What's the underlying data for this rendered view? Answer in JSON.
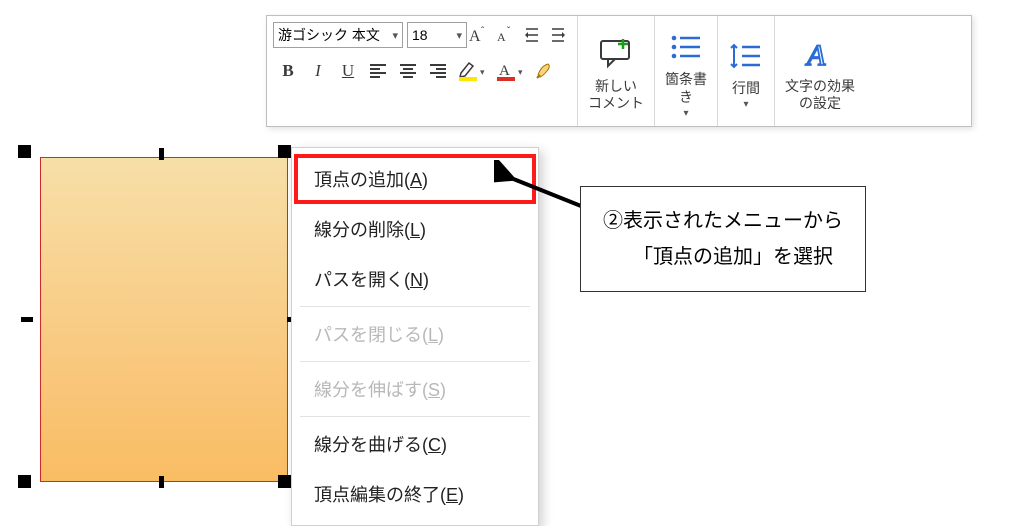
{
  "ribbon": {
    "font_name": "游ゴシック 本文",
    "font_size": "18",
    "btn_bold": "B",
    "btn_italic": "I",
    "btn_underline": "U",
    "btn_incfont": "A",
    "btn_decfont": "A",
    "new_comment": "新しい\nコメント",
    "bullets": "箇条書\nき",
    "line_spacing": "行間",
    "text_effects": "文字の効果\nの設定"
  },
  "context_menu": {
    "items": [
      {
        "label": "頂点の追加",
        "acc": "A",
        "enabled": true,
        "highlight": true
      },
      {
        "label": "線分の削除",
        "acc": "L",
        "enabled": true,
        "highlight": false
      },
      {
        "label": "パスを開く",
        "acc": "N",
        "enabled": true,
        "highlight": false
      },
      {
        "label": "パスを閉じる",
        "acc": "L",
        "enabled": false,
        "highlight": false
      },
      {
        "label": "線分を伸ばす",
        "acc": "S",
        "enabled": false,
        "highlight": false
      },
      {
        "label": "線分を曲げる",
        "acc": "C",
        "enabled": true,
        "highlight": false
      },
      {
        "label": "頂点編集の終了",
        "acc": "E",
        "enabled": true,
        "highlight": false
      }
    ]
  },
  "callout": {
    "line1": "②表示されたメニューから",
    "line2": "「頂点の追加」を選択"
  }
}
